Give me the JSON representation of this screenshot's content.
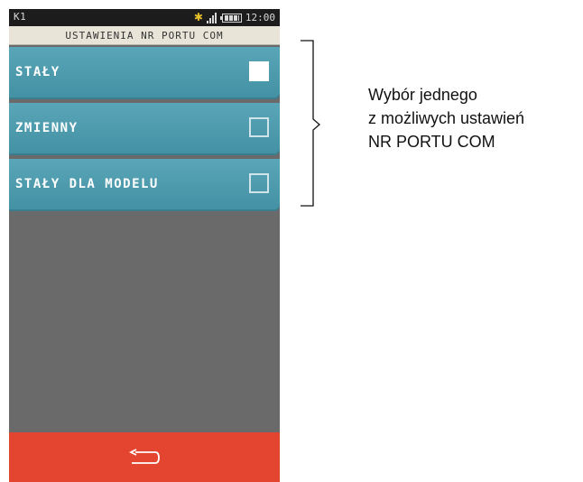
{
  "status": {
    "terminal_id": "K1",
    "time": "12:00",
    "icons": [
      "bluetooth-icon",
      "signal-icon",
      "battery-icon"
    ],
    "bluetooth_color": "#e7c02a"
  },
  "title": "USTAWIENIA NR PORTU COM",
  "options": [
    {
      "label": "STAŁY",
      "checked": true
    },
    {
      "label": "ZMIENNY",
      "checked": false
    },
    {
      "label": "STAŁY DLA MODELU",
      "checked": false
    }
  ],
  "bottom": {
    "icon": "back-arrow-icon",
    "color": "#e44531"
  },
  "annotation": {
    "line1": "Wybór jednego",
    "line2": "z możliwych ustawień",
    "line3": "NR PORTU COM"
  },
  "colors": {
    "menu_item": "#4b9aad",
    "background": "#6a6a6a",
    "titlebar": "#e8e4d8"
  }
}
